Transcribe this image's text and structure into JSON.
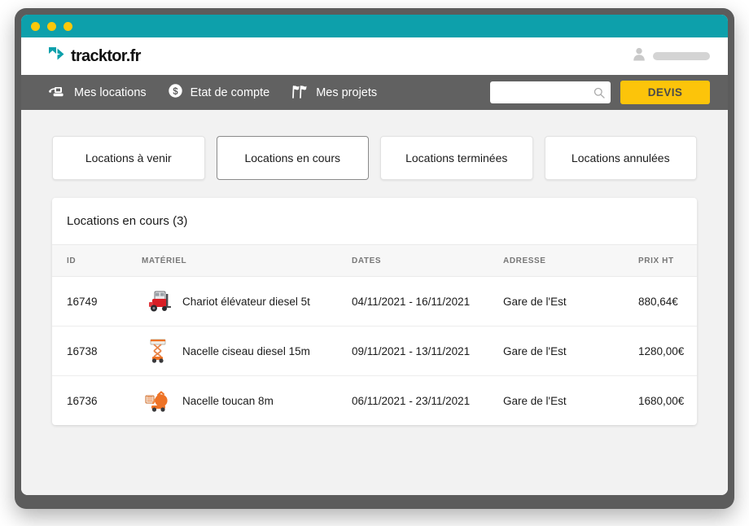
{
  "window": {
    "dots": [
      "close-dot",
      "minimize-dot",
      "maximize-dot"
    ],
    "titlebar_color": "#0da0ab"
  },
  "brand": {
    "name": "tracktor.fr",
    "mark_color": "#0da0ab"
  },
  "account": {
    "avatar_icon": "user-icon",
    "name_placeholder_redacted": ""
  },
  "nav": {
    "items": [
      {
        "label": "Mes locations",
        "icon": "excavator-icon"
      },
      {
        "label": "Etat de compte",
        "icon": "coin-dollar-icon"
      },
      {
        "label": "Mes projets",
        "icon": "flags-icon"
      }
    ],
    "search": {
      "value": "",
      "placeholder": "",
      "icon": "search-icon"
    },
    "devis_button": {
      "label": "DEVIS",
      "color": "#fcc40a"
    }
  },
  "tabs": [
    {
      "label": "Locations à venir",
      "active": false
    },
    {
      "label": "Locations en cours",
      "active": true
    },
    {
      "label": "Locations terminées",
      "active": false
    },
    {
      "label": "Locations annulées",
      "active": false
    }
  ],
  "card": {
    "title": "Locations en cours (3)",
    "columns": [
      "ID",
      "MATÉRIEL",
      "DATES",
      "ADRESSE",
      "PRIX HT"
    ],
    "rows": [
      {
        "id": "16749",
        "material": "Chariot élévateur diesel 5t",
        "thumb": "forklift-red-icon",
        "dates": "04/11/2021 - 16/11/2021",
        "address": "Gare de l'Est",
        "price": "880,64€"
      },
      {
        "id": "16738",
        "material": "Nacelle ciseau diesel 15m",
        "thumb": "scissor-lift-orange-icon",
        "dates": "09/11/2021 - 13/11/2021",
        "address": "Gare de l'Est",
        "price": "1280,00€"
      },
      {
        "id": "16736",
        "material": "Nacelle toucan 8m",
        "thumb": "toucan-lift-orange-icon",
        "dates": "06/11/2021 - 23/11/2021",
        "address": "Gare de l'Est",
        "price": "1680,00€"
      }
    ]
  }
}
